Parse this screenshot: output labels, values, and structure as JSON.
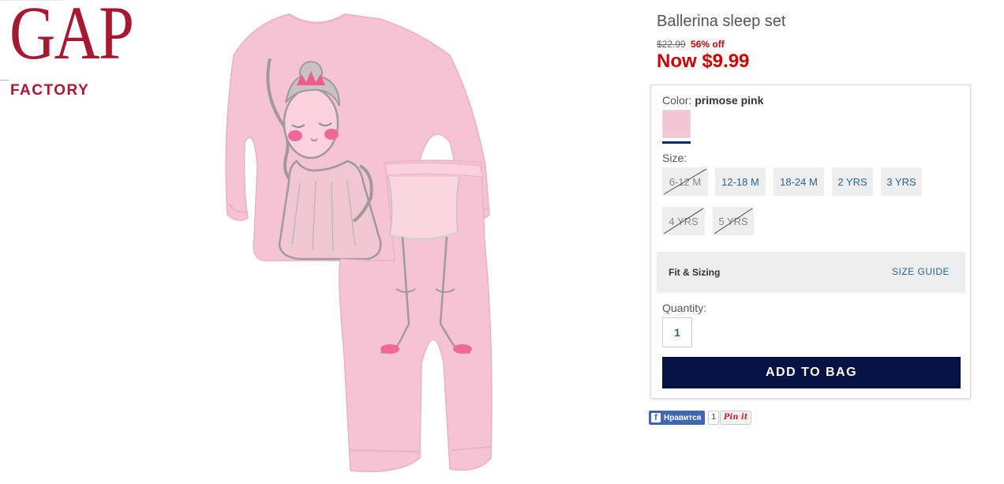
{
  "brand": {
    "logo_word": "GAP",
    "sub_word": "FACTORY",
    "color": "#a71930"
  },
  "product": {
    "title": "Ballerina sleep set",
    "original_price": "$22.99",
    "discount": "56% off",
    "now_price": "Now $9.99",
    "image_alt": "Pink ballerina pajama set"
  },
  "color": {
    "label": "Color:",
    "selected": "primose pink",
    "swatch_hex": "#f4c7d6"
  },
  "size": {
    "label": "Size:",
    "options": [
      {
        "label": "6-12 M",
        "available": false
      },
      {
        "label": "12-18 M",
        "available": true
      },
      {
        "label": "18-24 M",
        "available": true
      },
      {
        "label": "2 YRS",
        "available": true
      },
      {
        "label": "3 YRS",
        "available": true
      },
      {
        "label": "4 YRS",
        "available": false
      },
      {
        "label": "5 YRS",
        "available": false
      }
    ]
  },
  "fit": {
    "label": "Fit & Sizing",
    "guide_link": "SIZE GUIDE"
  },
  "quantity": {
    "label": "Quantity:",
    "value": "1"
  },
  "cart": {
    "add_label": "ADD TO BAG",
    "button_color": "#051243"
  },
  "social": {
    "fb_like": "Нравится",
    "fb_count": "1",
    "pin_label": "Pin it"
  }
}
